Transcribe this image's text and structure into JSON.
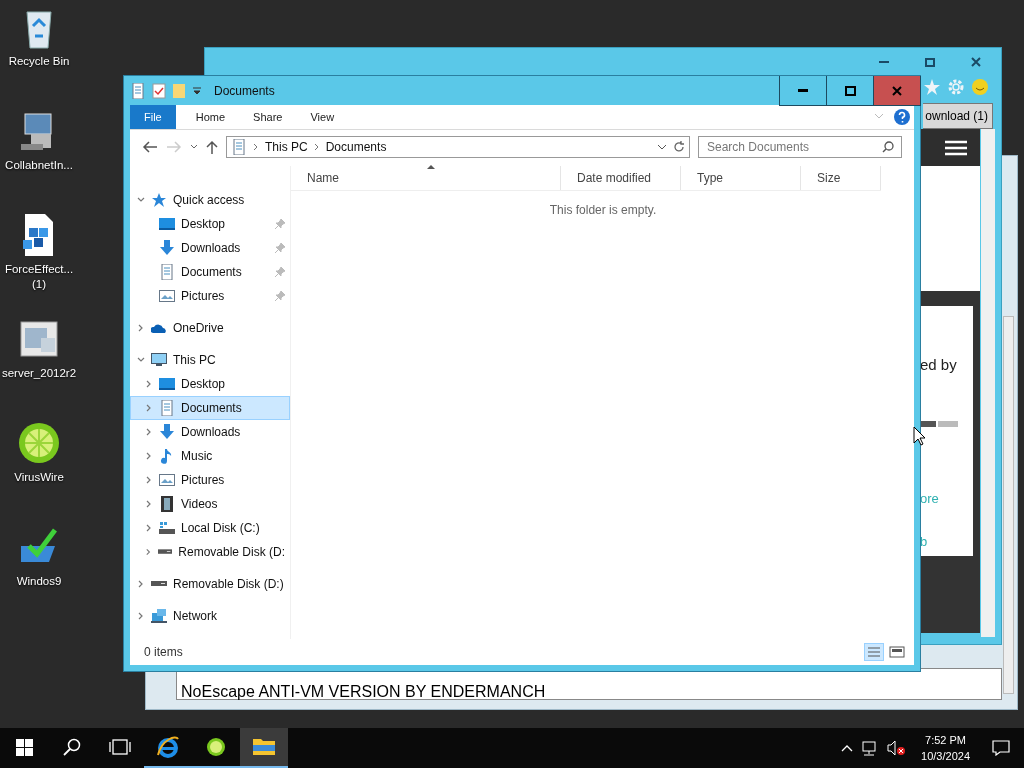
{
  "desktop_icons": [
    {
      "kind": "recycle",
      "lines": [
        "Recycle Bin"
      ]
    },
    {
      "kind": "computer",
      "lines": [
        "CollabnetIn..."
      ]
    },
    {
      "kind": "cubes",
      "lines": [
        "ForceEffect...",
        "(1)"
      ]
    },
    {
      "kind": "server",
      "lines": [
        "server_2012r2"
      ]
    },
    {
      "kind": "lime",
      "lines": [
        "VirusWire"
      ]
    },
    {
      "kind": "installer",
      "lines": [
        "Windos9"
      ]
    }
  ],
  "back_window": {
    "text_field": "NoEscape ANTI-VM VERSION BY ENDERMANCH"
  },
  "browser": {
    "download_button": "ownload (1)",
    "texts": [
      {
        "kind": "heading",
        "text": "ed by"
      },
      {
        "kind": "link",
        "text": "ore"
      },
      {
        "kind": "link",
        "text": "b"
      }
    ]
  },
  "explorer": {
    "title": "Documents",
    "ribbon_tabs": [
      {
        "kind": "file",
        "label": "File"
      },
      {
        "kind": "tab",
        "label": "Home"
      },
      {
        "kind": "tab",
        "label": "Share"
      },
      {
        "kind": "tab",
        "label": "View"
      }
    ],
    "address": [
      "This PC",
      "Documents"
    ],
    "search": {
      "placeholder": "Search Documents"
    },
    "columns": [
      "Name",
      "Date modified",
      "Type",
      "Size"
    ],
    "empty_message": "This folder is empty.",
    "nav": [
      {
        "kind": "quick",
        "label": "Quick access",
        "expanded": true,
        "selected": false,
        "children": [
          {
            "kind": "desktop",
            "label": "Desktop",
            "pinned": true,
            "selected": false
          },
          {
            "kind": "downloads",
            "label": "Downloads",
            "pinned": true,
            "selected": false
          },
          {
            "kind": "documents",
            "label": "Documents",
            "pinned": true,
            "selected": false
          },
          {
            "kind": "pictures",
            "label": "Pictures",
            "pinned": true,
            "selected": false
          }
        ]
      },
      {
        "kind": "onedrive",
        "label": "OneDrive",
        "expanded": false,
        "selected": false
      },
      {
        "kind": "thispc",
        "label": "This PC",
        "expanded": true,
        "selected": false,
        "children": [
          {
            "kind": "desktop",
            "label": "Desktop",
            "expanded": false,
            "selected": false
          },
          {
            "kind": "documents",
            "label": "Documents",
            "expanded": false,
            "selected": true
          },
          {
            "kind": "downloads",
            "label": "Downloads",
            "expanded": false,
            "selected": false
          },
          {
            "kind": "music",
            "label": "Music",
            "expanded": false,
            "selected": false
          },
          {
            "kind": "pictures",
            "label": "Pictures",
            "expanded": false,
            "selected": false
          },
          {
            "kind": "videos",
            "label": "Videos",
            "expanded": false,
            "selected": false
          },
          {
            "kind": "disk",
            "label": "Local Disk (C:)",
            "expanded": false,
            "selected": false
          },
          {
            "kind": "removable",
            "label": "Removable Disk (D:",
            "expanded": false,
            "selected": false
          }
        ]
      },
      {
        "kind": "removable",
        "label": "Removable Disk (D:)",
        "expanded": false,
        "selected": false
      },
      {
        "kind": "network",
        "label": "Network",
        "expanded": false,
        "selected": false
      }
    ],
    "status": "0 items"
  },
  "taskbar": {
    "apps": [
      {
        "kind": "ie",
        "running": true,
        "selected": false
      },
      {
        "kind": "lime",
        "running": true,
        "selected": false
      },
      {
        "kind": "explorer",
        "running": true,
        "selected": true
      }
    ],
    "time": "7:52 PM",
    "date": "10/3/2024"
  }
}
